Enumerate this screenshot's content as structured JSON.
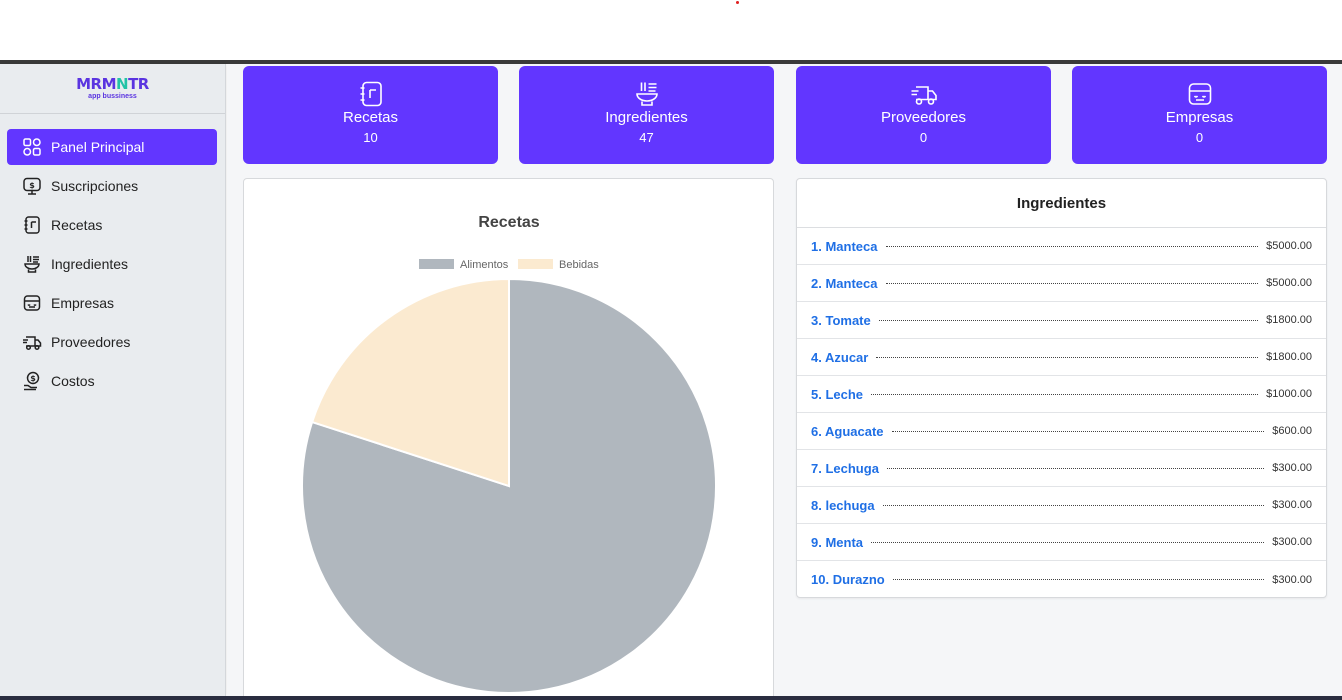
{
  "logo": {
    "main_a": "MRM",
    "main_b": "N",
    "main_c": "TR",
    "sub": "app bussiness"
  },
  "sidebar": {
    "items": [
      {
        "label": "Panel Principal",
        "icon": "dashboard-icon",
        "active": true
      },
      {
        "label": "Suscripciones",
        "icon": "subscription-icon"
      },
      {
        "label": "Recetas",
        "icon": "recipe-book-icon"
      },
      {
        "label": "Ingredientes",
        "icon": "ingredients-bowl-icon"
      },
      {
        "label": "Empresas",
        "icon": "store-icon"
      },
      {
        "label": "Proveedores",
        "icon": "truck-icon"
      },
      {
        "label": "Costos",
        "icon": "money-hand-icon"
      }
    ]
  },
  "stats": [
    {
      "title": "Recetas",
      "value": "10",
      "icon": "recipe-book-icon"
    },
    {
      "title": "Ingredientes",
      "value": "47",
      "icon": "ingredients-bowl-icon"
    },
    {
      "title": "Proveedores",
      "value": "0",
      "icon": "truck-icon"
    },
    {
      "title": "Empresas",
      "value": "0",
      "icon": "store-icon"
    }
  ],
  "chart_data": {
    "type": "pie",
    "title": "Recetas",
    "legend_position": "top",
    "categories": [
      "Alimentos",
      "Bebidas"
    ],
    "values": [
      8,
      2
    ],
    "colors": [
      "#b0b7be",
      "#fbead0"
    ]
  },
  "ingredients": {
    "title": "Ingredientes",
    "items": [
      {
        "num": "1.",
        "name": "Manteca",
        "price": "$5000.00"
      },
      {
        "num": "2.",
        "name": "Manteca",
        "price": "$5000.00"
      },
      {
        "num": "3.",
        "name": "Tomate",
        "price": "$1800.00"
      },
      {
        "num": "4.",
        "name": "Azucar",
        "price": "$1800.00"
      },
      {
        "num": "5.",
        "name": "Leche",
        "price": "$1000.00"
      },
      {
        "num": "6.",
        "name": "Aguacate",
        "price": "$600.00"
      },
      {
        "num": "7.",
        "name": "Lechuga",
        "price": "$300.00"
      },
      {
        "num": "8.",
        "name": "lechuga",
        "price": "$300.00"
      },
      {
        "num": "9.",
        "name": "Menta",
        "price": "$300.00"
      },
      {
        "num": "10.",
        "name": "Durazno",
        "price": "$300.00"
      }
    ]
  },
  "colors": {
    "accent": "#6236ff",
    "link": "#1f6fe5",
    "sidebar_bg": "#e9ecef"
  }
}
